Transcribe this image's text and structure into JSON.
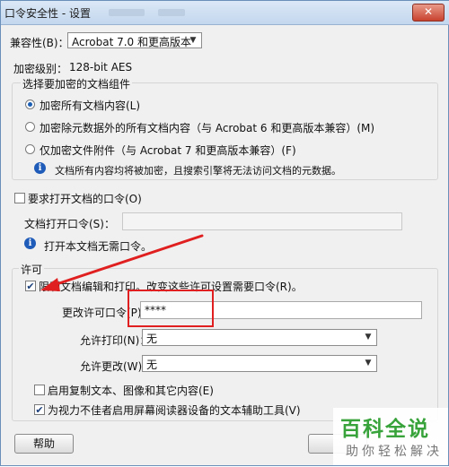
{
  "window": {
    "title": "口令安全性 - 设置",
    "close_glyph": "✕"
  },
  "compatibility": {
    "label": "兼容性(B)：",
    "selected": "Acrobat 7.0 和更高版本"
  },
  "encryption": {
    "label": "加密级别：",
    "value": "128-bit AES"
  },
  "components": {
    "legend": "选择要加密的文档组件",
    "options": [
      {
        "label": "加密所有文档内容(L)",
        "selected": true
      },
      {
        "label": "加密除元数据外的所有文档内容（与 Acrobat 6 和更高版本兼容）(M)",
        "selected": false
      },
      {
        "label": "仅加密文件附件（与 Acrobat 7 和更高版本兼容）(F)",
        "selected": false
      }
    ],
    "info": "文档所有内容均将被加密，且搜索引擎将无法访问文档的元数据。"
  },
  "open_password": {
    "checkbox_label": "要求打开文档的口令(O)",
    "checked": false,
    "field_label": "文档打开口令(S)：",
    "value": "",
    "info": "打开本文档无需口令。"
  },
  "permissions": {
    "legend": "许可",
    "restrict_label": "限制文档编辑和打印。改变这些许可设置需要口令(R)。",
    "restrict_checked": true,
    "change_password_label": "更改许可口令(P)：",
    "change_password_value": "****",
    "printing_label": "允许打印(N)：",
    "printing_value": "无",
    "changes_label": "允许更改(W)：",
    "changes_value": "无",
    "copy_label": "启用复制文本、图像和其它内容(E)",
    "copy_checked": false,
    "accessibility_label": "为视力不佳者启用屏幕阅读器设备的文本辅助工具(V)",
    "accessibility_checked": true
  },
  "buttons": {
    "help": "帮助"
  },
  "watermark": {
    "main": "百科全说",
    "sub": "助你轻松解决"
  },
  "colors": {
    "annotation": "#e02020",
    "arrow": "#e02020",
    "watermark": "#38a33a"
  }
}
